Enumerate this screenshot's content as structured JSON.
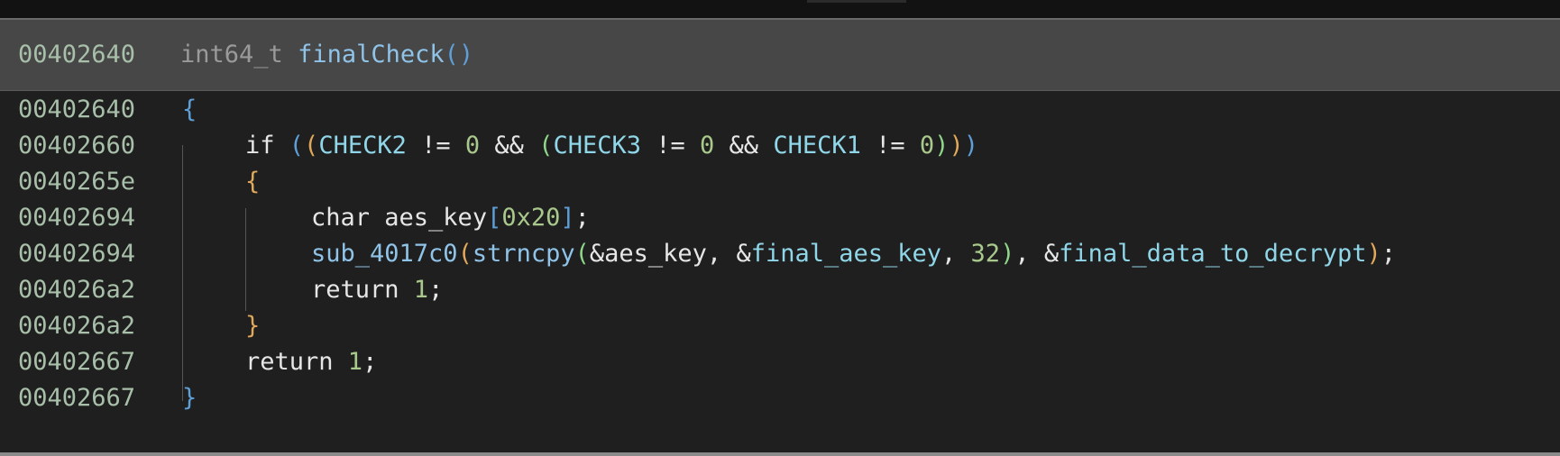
{
  "window": {
    "accent_color": "#474747",
    "background_color": "#1f1f1f"
  },
  "header": {
    "address": "00402640",
    "return_type": "int64_t",
    "function_name": "finalCheck",
    "parens": "()"
  },
  "lines": [
    {
      "address": "00402640",
      "indent": 0,
      "tokens": [
        {
          "t": "{",
          "c": "p1"
        }
      ]
    },
    {
      "address": "00402660",
      "indent": 1,
      "tokens": [
        {
          "t": "if ",
          "c": "kw"
        },
        {
          "t": "(",
          "c": "p1"
        },
        {
          "t": "(",
          "c": "p2"
        },
        {
          "t": "CHECK2",
          "c": "var"
        },
        {
          "t": " != ",
          "c": "op"
        },
        {
          "t": "0",
          "c": "num"
        },
        {
          "t": " && ",
          "c": "op"
        },
        {
          "t": "(",
          "c": "p3"
        },
        {
          "t": "CHECK3",
          "c": "var"
        },
        {
          "t": " != ",
          "c": "op"
        },
        {
          "t": "0",
          "c": "num"
        },
        {
          "t": " && ",
          "c": "op"
        },
        {
          "t": "CHECK1",
          "c": "var"
        },
        {
          "t": " != ",
          "c": "op"
        },
        {
          "t": "0",
          "c": "num"
        },
        {
          "t": ")",
          "c": "p3"
        },
        {
          "t": ")",
          "c": "p2"
        },
        {
          "t": ")",
          "c": "p1"
        }
      ]
    },
    {
      "address": "0040265e",
      "indent": 1,
      "tokens": [
        {
          "t": "{",
          "c": "p2"
        }
      ]
    },
    {
      "address": "00402694",
      "indent": 2,
      "tokens": [
        {
          "t": "char ",
          "c": "kw"
        },
        {
          "t": "aes_key",
          "c": "kw"
        },
        {
          "t": "[",
          "c": "p1"
        },
        {
          "t": "0x20",
          "c": "num"
        },
        {
          "t": "]",
          "c": "p1"
        },
        {
          "t": ";",
          "c": "op"
        }
      ]
    },
    {
      "address": "00402694",
      "indent": 2,
      "tokens": [
        {
          "t": "sub_4017c0",
          "c": "func"
        },
        {
          "t": "(",
          "c": "p2"
        },
        {
          "t": "strncpy",
          "c": "func"
        },
        {
          "t": "(",
          "c": "p3"
        },
        {
          "t": "&aes_key, &",
          "c": "op"
        },
        {
          "t": "final_aes_key",
          "c": "var"
        },
        {
          "t": ", ",
          "c": "op"
        },
        {
          "t": "32",
          "c": "num"
        },
        {
          "t": ")",
          "c": "p3"
        },
        {
          "t": ", &",
          "c": "op"
        },
        {
          "t": "final_data_to_decrypt",
          "c": "var"
        },
        {
          "t": ")",
          "c": "p2"
        },
        {
          "t": ";",
          "c": "op"
        }
      ]
    },
    {
      "address": "004026a2",
      "indent": 2,
      "tokens": [
        {
          "t": "return ",
          "c": "kw"
        },
        {
          "t": "1",
          "c": "num"
        },
        {
          "t": ";",
          "c": "op"
        }
      ]
    },
    {
      "address": "004026a2",
      "indent": 1,
      "tokens": [
        {
          "t": "}",
          "c": "p2"
        }
      ]
    },
    {
      "address": "00402667",
      "indent": 1,
      "tokens": [
        {
          "t": "return ",
          "c": "kw"
        },
        {
          "t": "1",
          "c": "num"
        },
        {
          "t": ";",
          "c": "op"
        }
      ]
    },
    {
      "address": "00402667",
      "indent": 0,
      "tokens": [
        {
          "t": "}",
          "c": "p1"
        }
      ]
    }
  ]
}
